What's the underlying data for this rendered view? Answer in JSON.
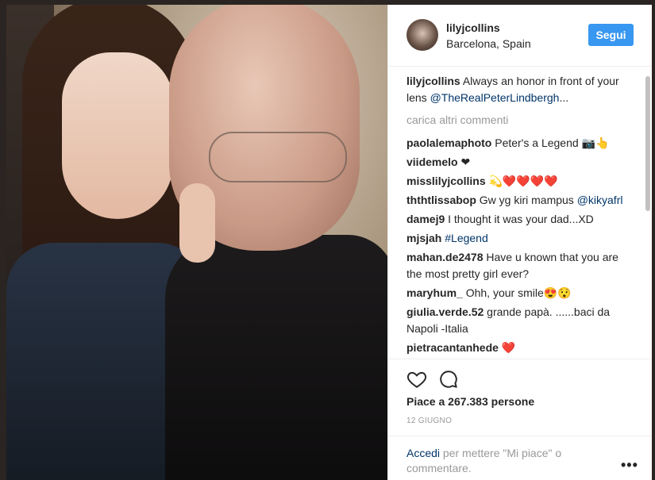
{
  "post": {
    "username": "lilyjcollins",
    "location": "Barcelona, Spain",
    "follow_label": "Segui",
    "caption_text": "Always an honor in front of your lens",
    "caption_mention": "@TheRealPeterLindbergh",
    "caption_suffix": "...",
    "load_more_label": "carica altri commenti"
  },
  "comments": [
    {
      "user": "paolalemaphoto",
      "text": "Peter's a Legend 📷👆"
    },
    {
      "user": "viidemelo",
      "text": "❤"
    },
    {
      "user": "misslilyjcollins",
      "text": "💫❤️❤️❤️❤️"
    },
    {
      "user": "ththtlissabop",
      "text": "Gw yg kiri mampus",
      "mention": "@kikyafrl"
    },
    {
      "user": "damej9",
      "text": "I thought it was your dad...XD"
    },
    {
      "user": "mjsjah",
      "mention": "#Legend"
    },
    {
      "user": "mahan.de2478",
      "text": "Have u known that you are the most pretty girl ever?"
    },
    {
      "user": "maryhum_",
      "text": "Ohh, your smile😍😯"
    },
    {
      "user": "giulia.verde.52",
      "text": "grande papà. ......baci da Napoli -Italia"
    },
    {
      "user": "pietracantanhede",
      "text": "❤️"
    }
  ],
  "actions": {
    "likes": "Piace a 267.383 persone",
    "date": "12 GIUGNO",
    "login_link": "Accedi",
    "login_rest": "per mettere \"Mi piace\" o commentare.",
    "more_label": "•••",
    "like_icon": "heart-icon",
    "comment_icon": "comment-icon"
  }
}
